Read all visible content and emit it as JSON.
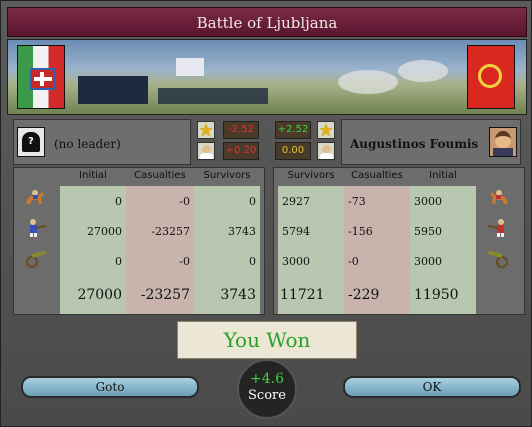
{
  "title": "Battle of Ljubljana",
  "left": {
    "leader": "(no leader)",
    "stat1": "-2.52",
    "stat2": "+0.20",
    "headers": [
      "Initial",
      "Casualties",
      "Survivors"
    ],
    "rows": [
      {
        "unit": "cavalry",
        "initial": "0",
        "casualties": "-0",
        "survivors": "0"
      },
      {
        "unit": "infantry",
        "initial": "27000",
        "casualties": "-23257",
        "survivors": "3743"
      },
      {
        "unit": "artillery",
        "initial": "0",
        "casualties": "-0",
        "survivors": "0"
      }
    ],
    "totals": {
      "initial": "27000",
      "casualties": "-23257",
      "survivors": "3743"
    }
  },
  "right": {
    "leader": "Augustinos Foumis",
    "stat1": "+2.52",
    "stat2": "0.00",
    "headers": [
      "Survivors",
      "Casualties",
      "Initial"
    ],
    "rows": [
      {
        "unit": "cavalry",
        "survivors": "2927",
        "casualties": "-73",
        "initial": "3000"
      },
      {
        "unit": "infantry",
        "survivors": "5794",
        "casualties": "-156",
        "initial": "5950"
      },
      {
        "unit": "artillery",
        "survivors": "3000",
        "casualties": "-0",
        "initial": "3000"
      }
    ],
    "totals": {
      "survivors": "11721",
      "casualties": "-229",
      "initial": "11950"
    }
  },
  "result": "You Won",
  "buttons": {
    "goto": "Goto",
    "ok": "OK"
  },
  "score": {
    "value": "+4.6",
    "label": "Score"
  },
  "colors": {
    "title_bg": "#6a1f3a",
    "win_text": "#2aa02a",
    "neg": "#e03030",
    "pos": "#40d040",
    "zero": "#e0c030"
  }
}
